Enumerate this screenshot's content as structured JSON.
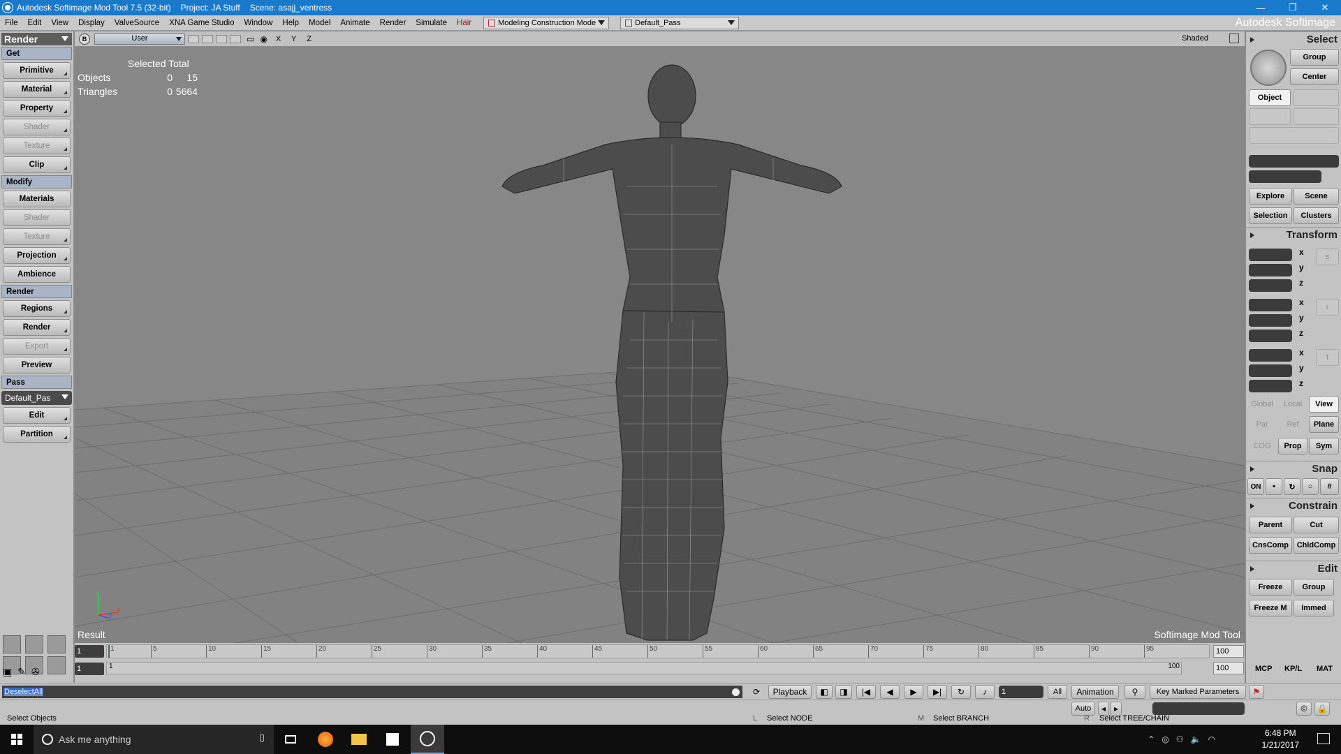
{
  "window": {
    "title": "Autodesk Softimage Mod Tool 7.5 (32-bit)",
    "project": "Project: JA Stuff",
    "scene": "Scene: asajj_ventress",
    "controls": [
      "—",
      "❐",
      "✕"
    ]
  },
  "menu": {
    "items": [
      "File",
      "Edit",
      "View",
      "Display",
      "ValveSource",
      "XNA Game Studio",
      "Window",
      "Help",
      "Model",
      "Animate",
      "Render",
      "Simulate",
      "Hair"
    ],
    "mode_combo": "Modeling Construction Mode",
    "pass_combo": "Default_Pass",
    "brand": "Autodesk Softimage"
  },
  "left_panel": {
    "module": "Render",
    "get_header": "Get",
    "get_buttons": [
      {
        "label": "Primitive",
        "disabled": false,
        "menu": true
      },
      {
        "label": "Material",
        "disabled": false,
        "menu": true
      },
      {
        "label": "Property",
        "disabled": false,
        "menu": true
      },
      {
        "label": "Shader",
        "disabled": true,
        "menu": true
      },
      {
        "label": "Texture",
        "disabled": true,
        "menu": true
      },
      {
        "label": "Clip",
        "disabled": false,
        "menu": true
      }
    ],
    "modify_header": "Modify",
    "modify_buttons": [
      {
        "label": "Materials",
        "disabled": false,
        "menu": false
      },
      {
        "label": "Shader",
        "disabled": true,
        "menu": false
      },
      {
        "label": "Texture",
        "disabled": true,
        "menu": true
      },
      {
        "label": "Projection",
        "disabled": false,
        "menu": true
      },
      {
        "label": "Ambience",
        "disabled": false,
        "menu": false
      }
    ],
    "render_header": "Render",
    "render_buttons": [
      {
        "label": "Regions",
        "disabled": false,
        "menu": true
      },
      {
        "label": "Render",
        "disabled": false,
        "menu": true
      },
      {
        "label": "Export",
        "disabled": true,
        "menu": true
      },
      {
        "label": "Preview",
        "disabled": false,
        "menu": false
      }
    ],
    "pass_header": "Pass",
    "pass_combo": "Default_Pas",
    "pass_buttons": [
      {
        "label": "Edit",
        "disabled": false,
        "menu": true
      },
      {
        "label": "Partition",
        "disabled": false,
        "menu": true
      }
    ]
  },
  "viewport": {
    "camera": "User",
    "badge": "B",
    "axes": "X Y Z",
    "display_mode": "Shaded",
    "stats": {
      "header": "Selected Total",
      "rows": [
        {
          "label": "Objects",
          "selected": "0",
          "total": "15"
        },
        {
          "label": "Triangles",
          "selected": "0",
          "total": "5664"
        }
      ]
    },
    "result_label": "Result",
    "brand_label": "Softimage  Mod  Tool",
    "axis_y": "Y",
    "axis_x": "X",
    "axis_z": "Z"
  },
  "right_panel": {
    "select_title": "Select",
    "group_btn": "Group",
    "center_btn": "Center",
    "object_btn": "Object",
    "explore_btn": "Explore",
    "scene_btn": "Scene",
    "selection_btn": "Selection",
    "clusters_btn": "Clusters",
    "transform_title": "Transform",
    "axes": [
      "x",
      "y",
      "z"
    ],
    "space_btns": [
      "Global",
      "Local",
      "View"
    ],
    "ref_btns": [
      "Par",
      "Ref",
      "Plane"
    ],
    "misc_btns": [
      "COG",
      "Prop",
      "Sym"
    ],
    "snap_title": "Snap",
    "snap_on": "ON",
    "constrain_title": "Constrain",
    "parent_btn": "Parent",
    "cut_btn": "Cut",
    "cnscomp_btn": "CnsComp",
    "chldcomp_btn": "ChldComp",
    "edit_title": "Edit",
    "freeze_btn": "Freeze",
    "group2_btn": "Group",
    "freezem_btn": "Freeze M",
    "immed_btn": "Immed",
    "tabs": [
      "MCP",
      "KP/L",
      "MAT"
    ]
  },
  "timeline": {
    "start": "1",
    "end": "100",
    "range_start": "1",
    "range_label": "1",
    "range_end": "100",
    "range_end2": "100",
    "cursor_frame": "1",
    "ticks": [
      "1",
      "5",
      "10",
      "15",
      "20",
      "25",
      "30",
      "35",
      "40",
      "45",
      "50",
      "55",
      "60",
      "65",
      "70",
      "75",
      "80",
      "85",
      "90",
      "95"
    ]
  },
  "command": {
    "input": "DeselectAll",
    "playback": "Playback",
    "frame": "1",
    "all": "All",
    "animation": "Animation",
    "auto": "Auto",
    "key_marked": "Key Marked Parameters"
  },
  "status": {
    "message": "Select Objects",
    "l_key": "L",
    "l_text": "Select NODE",
    "m_key": "M",
    "m_text": "Select BRANCH",
    "r_key": "R",
    "r_text": "Select TREE/CHAIN"
  },
  "taskbar": {
    "search_placeholder": "Ask me anything",
    "time": "6:48 PM",
    "date": "1/21/2017"
  }
}
